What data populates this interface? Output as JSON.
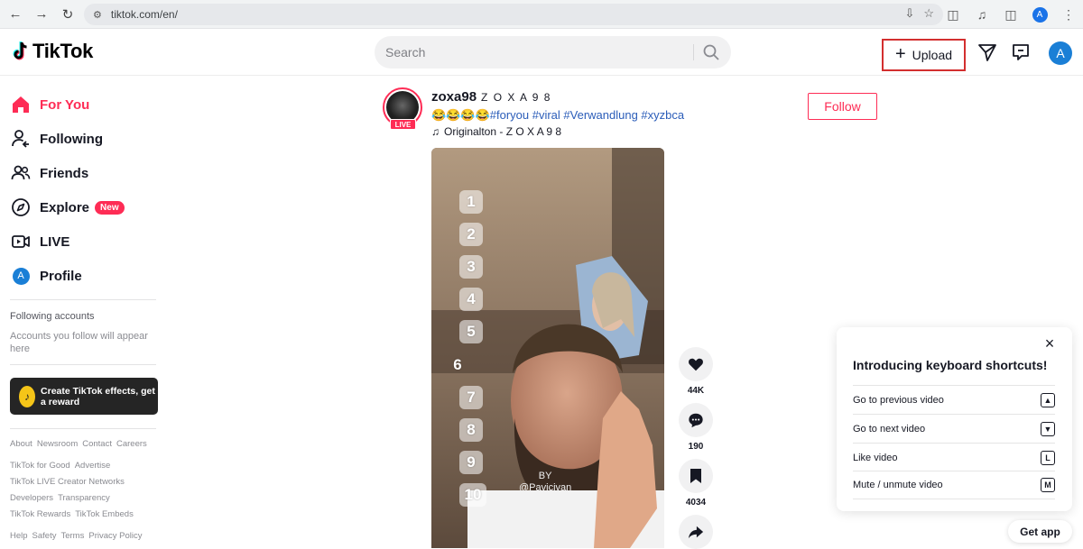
{
  "browser": {
    "url": "tiktok.com/en/",
    "profile_initial": "A"
  },
  "header": {
    "brand": "TikTok",
    "search_placeholder": "Search",
    "upload_label": "Upload",
    "avatar_initial": "A"
  },
  "sidebar": {
    "items": [
      {
        "label": "For You",
        "icon": "home-icon",
        "active": true
      },
      {
        "label": "Following",
        "icon": "following-icon"
      },
      {
        "label": "Friends",
        "icon": "friends-icon"
      },
      {
        "label": "Explore",
        "icon": "compass-icon",
        "badge": "New"
      },
      {
        "label": "LIVE",
        "icon": "live-icon"
      },
      {
        "label": "Profile",
        "icon": "profile-avatar",
        "avatar_initial": "A"
      }
    ],
    "following_title": "Following accounts",
    "following_sub": "Accounts you follow will appear here",
    "effects_banner": "Create TikTok effects, get a reward",
    "footer_rows": [
      [
        "About",
        "Newsroom",
        "Contact",
        "Careers"
      ],
      [
        "TikTok for Good",
        "Advertise"
      ],
      [
        "TikTok LIVE Creator Networks"
      ],
      [
        "Developers",
        "Transparency"
      ],
      [
        "TikTok Rewards",
        "TikTok Embeds"
      ],
      [
        "Help",
        "Safety",
        "Terms",
        "Privacy Policy"
      ]
    ]
  },
  "post": {
    "username": "zoxa98",
    "display_name": "Z O X A 9 8",
    "live_tag": "LIVE",
    "caption_emoji": "😂😂😂😂",
    "caption_tags": "#foryou #viral #Verwandlung #xyzbca",
    "music": "Originalton - Z O X A 9 8",
    "follow_label": "Follow",
    "video_numbers": [
      "1",
      "2",
      "3",
      "4",
      "5",
      "6",
      "7",
      "8",
      "9",
      "10"
    ],
    "watermark_by": "BY",
    "watermark_handle": "@Pavicivan",
    "likes": "44K",
    "comments": "190",
    "saves": "4034"
  },
  "shortcuts": {
    "title": "Introducing keyboard shortcuts!",
    "rows": [
      {
        "label": "Go to previous video",
        "key": "▲"
      },
      {
        "label": "Go to next video",
        "key": "▼"
      },
      {
        "label": "Like video",
        "key": "L"
      },
      {
        "label": "Mute / unmute video",
        "key": "M"
      }
    ]
  },
  "get_app_label": "Get app"
}
